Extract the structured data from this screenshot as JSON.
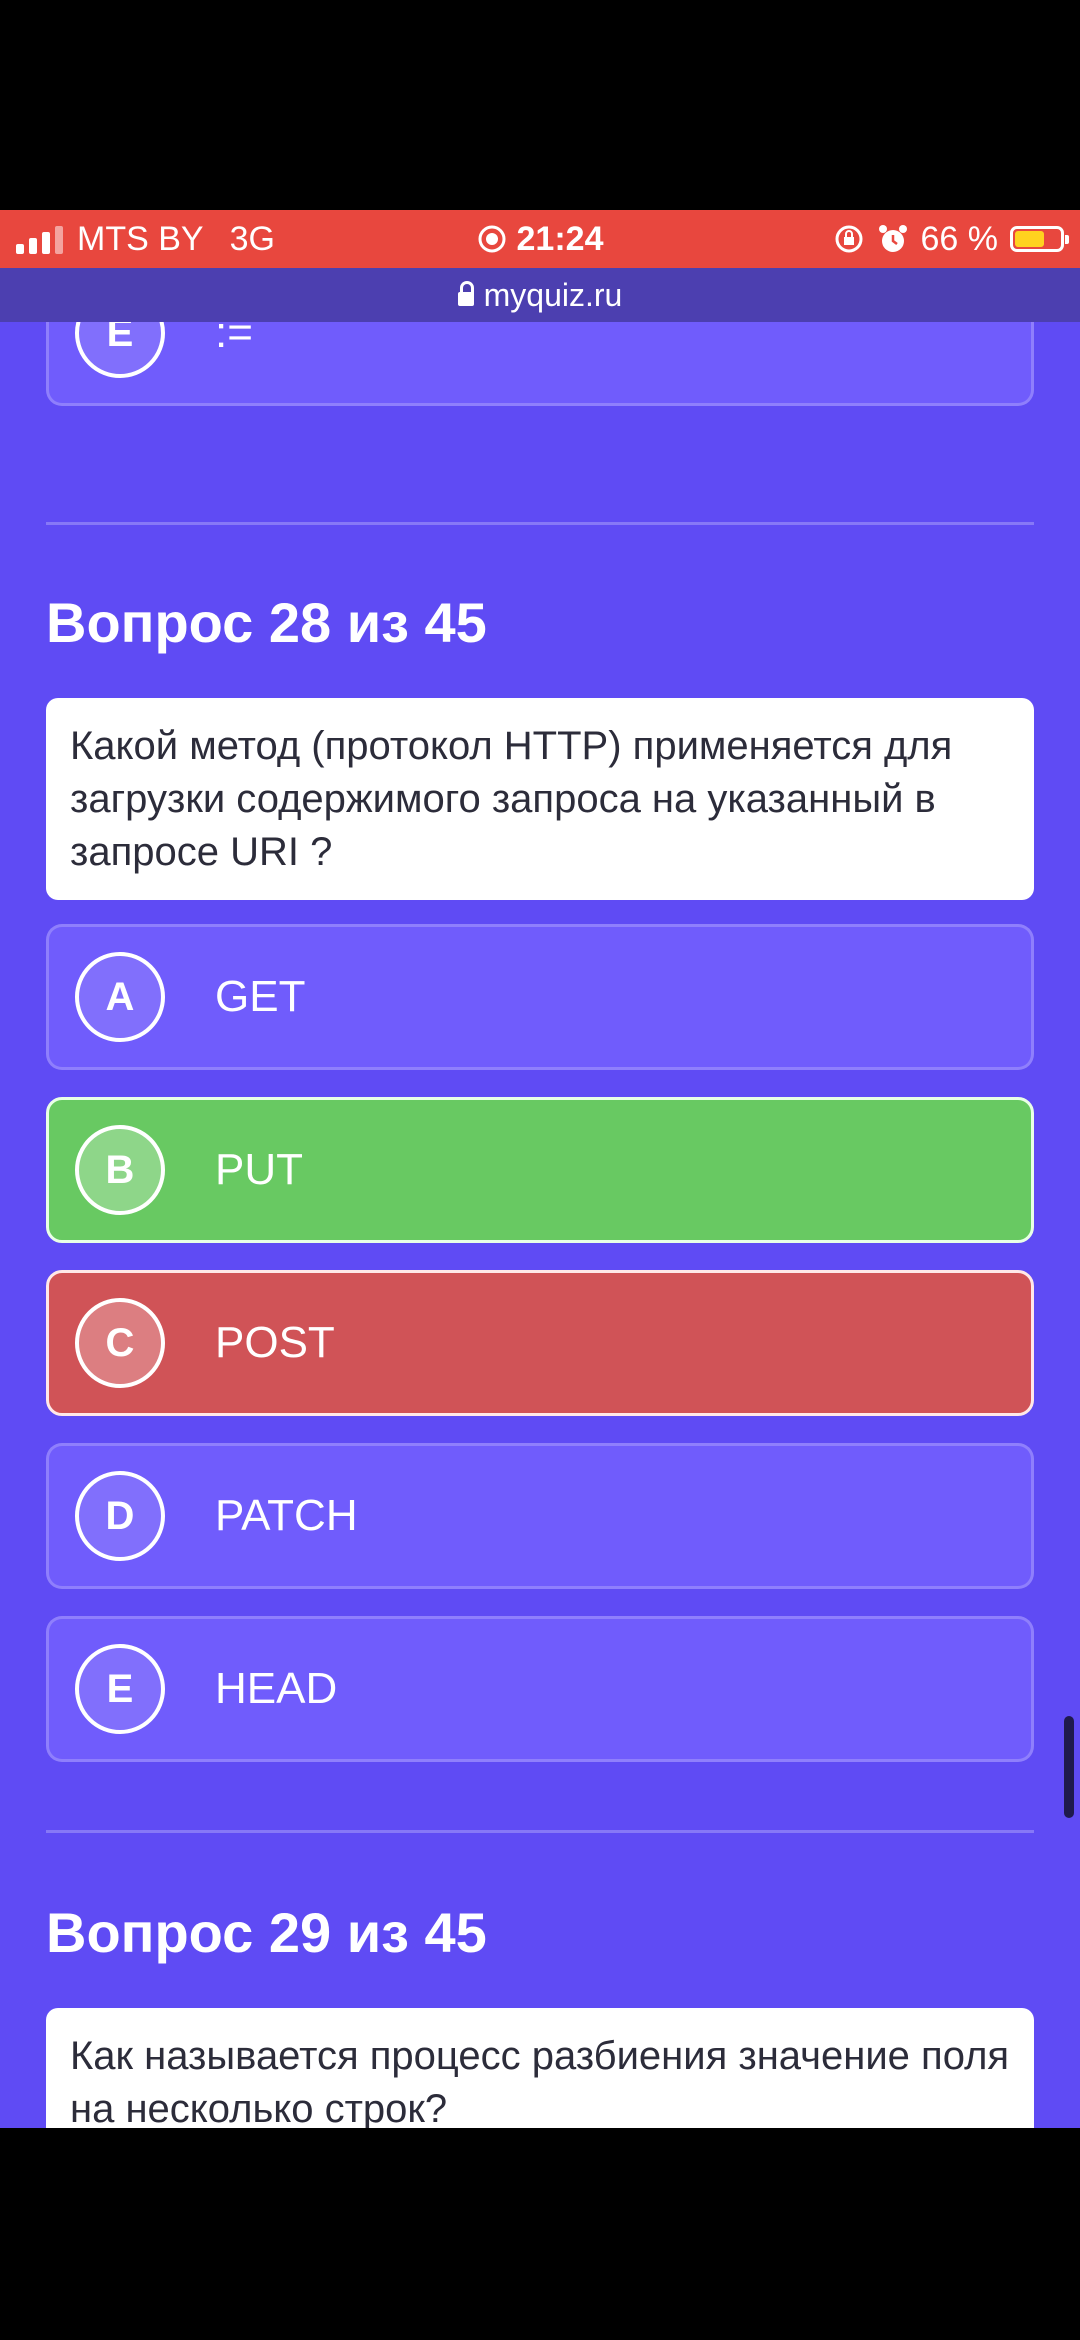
{
  "status_bar": {
    "carrier": "MTS BY",
    "network": "3G",
    "time": "21:24",
    "battery": "66 %",
    "battery_level": 0.66
  },
  "url_bar": {
    "url": "myquiz.ru"
  },
  "prev_question": {
    "last_option": {
      "letter": "E",
      "text": ":="
    }
  },
  "question_28": {
    "heading": "Вопрос 28 из 45",
    "text": "Какой метод (протокол HTTP) применяется для загрузки содержимого запроса на указанный в запросе URI ?",
    "options": [
      {
        "letter": "A",
        "text": "GET",
        "state": "neutral"
      },
      {
        "letter": "B",
        "text": "PUT",
        "state": "correct"
      },
      {
        "letter": "C",
        "text": "POST",
        "state": "wrong"
      },
      {
        "letter": "D",
        "text": "PATCH",
        "state": "neutral"
      },
      {
        "letter": "E",
        "text": "HEAD",
        "state": "neutral"
      }
    ]
  },
  "question_29": {
    "heading": "Вопрос 29 из 45",
    "text": "Как называется процесс разбиения значение поля на несколько строк?"
  },
  "colors": {
    "background": "#5f4bf4",
    "option": "#705cfc",
    "correct": "#68c962",
    "wrong": "#d05357",
    "status_bar": "#e8473e"
  }
}
